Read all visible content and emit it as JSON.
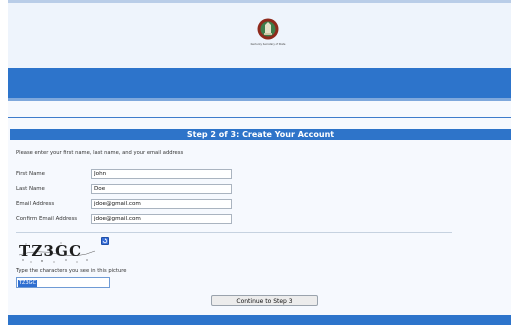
{
  "header": {
    "logo_icon": "government-seal-icon",
    "logo_caption": "Kentucky Secretary of State"
  },
  "form": {
    "step_title": "Step 2 of 3: Create Your Account",
    "intro": "Please enter your first name, last name, and your email address",
    "fields": [
      {
        "label": "First Name",
        "value": "John"
      },
      {
        "label": "Last Name",
        "value": "Doe"
      },
      {
        "label": "Email Address",
        "value": "jdoe@gmail.com"
      },
      {
        "label": "Confirm Email Address",
        "value": "jdoe@gmail.com"
      }
    ],
    "captcha": {
      "image_text": "TZ3GC",
      "refresh_icon": "refresh-icon",
      "prompt": "Type the characters you see in this picture",
      "input_value": "TZ3GC"
    },
    "continue_label": "Continue to Step 3"
  },
  "colors": {
    "nav_blue": "#2d74cb",
    "title_bar": "#2e74c9",
    "page_bg": "#f6f9fe",
    "selection": "#2f6fd1"
  }
}
